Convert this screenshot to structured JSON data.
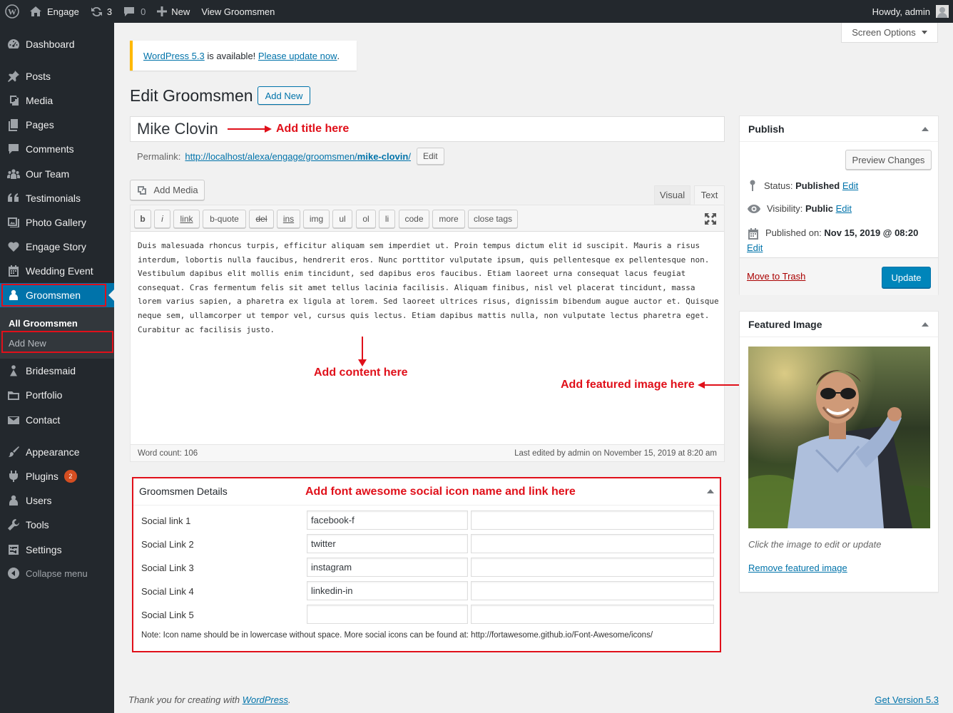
{
  "admin_bar": {
    "site_name": "Engage",
    "updates_count": "3",
    "comments_count": "0",
    "new_label": "New",
    "view_label": "View Groomsmen",
    "howdy": "Howdy, admin"
  },
  "sidebar": {
    "items": [
      {
        "label": "Dashboard",
        "icon": "dashboard-icon"
      },
      {
        "label": "Posts",
        "icon": "pin-icon"
      },
      {
        "label": "Media",
        "icon": "media-icon"
      },
      {
        "label": "Pages",
        "icon": "pages-icon"
      },
      {
        "label": "Comments",
        "icon": "comment-icon"
      },
      {
        "label": "Our Team",
        "icon": "groups-icon"
      },
      {
        "label": "Testimonials",
        "icon": "quote-icon"
      },
      {
        "label": "Photo Gallery",
        "icon": "gallery-icon"
      },
      {
        "label": "Engage Story",
        "icon": "heart-icon"
      },
      {
        "label": "Wedding Event",
        "icon": "calendar-icon"
      },
      {
        "label": "Groomsmen",
        "icon": "user-icon"
      },
      {
        "label": "Bridesmaid",
        "icon": "woman-icon"
      },
      {
        "label": "Portfolio",
        "icon": "portfolio-icon"
      },
      {
        "label": "Contact",
        "icon": "email-icon"
      },
      {
        "label": "Appearance",
        "icon": "brush-icon"
      },
      {
        "label": "Plugins",
        "icon": "plugin-icon",
        "badge": "2"
      },
      {
        "label": "Users",
        "icon": "users-icon"
      },
      {
        "label": "Tools",
        "icon": "wrench-icon"
      },
      {
        "label": "Settings",
        "icon": "settings-icon"
      },
      {
        "label": "Collapse menu",
        "icon": "collapse-icon"
      }
    ],
    "submenu": {
      "all": "All Groomsmen",
      "add_new": "Add New"
    }
  },
  "screen_options": "Screen Options",
  "notice": {
    "link1": "WordPress 5.3",
    "middle": " is available! ",
    "link2": "Please update now",
    "end": "."
  },
  "page": {
    "title": "Edit Groomsmen",
    "add_new": "Add New"
  },
  "post": {
    "title": "Mike Clovin",
    "permalink_label": "Permalink:",
    "permalink_base": "http://localhost/alexa/engage/groomsmen/",
    "permalink_slug": "mike-clovin",
    "permalink_end": "/",
    "permalink_edit": "Edit"
  },
  "editor": {
    "add_media": "Add Media",
    "tab_visual": "Visual",
    "tab_text": "Text",
    "quicktags": [
      "b",
      "i",
      "link",
      "b-quote",
      "del",
      "ins",
      "img",
      "ul",
      "ol",
      "li",
      "code",
      "more",
      "close tags"
    ],
    "content": "Duis malesuada rhoncus turpis, efficitur aliquam sem imperdiet ut. Proin tempus dictum elit id suscipit. Mauris a risus interdum, lobortis nulla faucibus, hendrerit eros. Nunc porttitor vulputate ipsum, quis pellentesque ex pellentesque non. Vestibulum dapibus elit mollis enim tincidunt, sed dapibus eros faucibus. Etiam laoreet urna consequat lacus feugiat consequat. Cras fermentum felis sit amet tellus lacinia facilisis. Aliquam finibus, nisl vel placerat tincidunt, massa lorem varius sapien, a pharetra ex ligula at lorem. Sed laoreet ultrices risus, dignissim bibendum augue auctor et. Quisque neque sem, ullamcorper ut tempor vel, cursus quis lectus. Etiam dapibus mattis nulla, non vulputate lectus pharetra eget. Curabitur ac facilisis justo.",
    "word_count": "Word count: 106",
    "last_edited": "Last edited by admin on November 15, 2019 at 8:20 am"
  },
  "annotations": {
    "title": "Add title here",
    "content": "Add content here",
    "featured": "Add featured image here",
    "social": "Add font awesome social icon name and link here"
  },
  "groomsmen_details": {
    "title": "Groomsmen Details",
    "rows": [
      {
        "label": "Social link 1",
        "icon": "facebook-f",
        "link": ""
      },
      {
        "label": "Social Link 2",
        "icon": "twitter",
        "link": ""
      },
      {
        "label": "Social Link 3",
        "icon": "instagram",
        "link": ""
      },
      {
        "label": "Social Link 4",
        "icon": "linkedin-in",
        "link": ""
      },
      {
        "label": "Social Link 5",
        "icon": "",
        "link": ""
      }
    ],
    "note": "Note: Icon name should be in lowercase without space. More social icons can be found at: http://fortawesome.github.io/Font-Awesome/icons/"
  },
  "publish": {
    "title": "Publish",
    "preview": "Preview Changes",
    "status_label": "Status:",
    "status_value": "Published",
    "visibility_label": "Visibility:",
    "visibility_value": "Public",
    "published_label": "Published on:",
    "published_value": "Nov 15, 2019 @ 08:20",
    "edit": "Edit",
    "trash": "Move to Trash",
    "update": "Update"
  },
  "featured_image": {
    "title": "Featured Image",
    "hint": "Click the image to edit or update",
    "remove": "Remove featured image"
  },
  "footer": {
    "thanks_prefix": "Thank you for creating with ",
    "thanks_link": "WordPress",
    "thanks_end": ".",
    "version": "Get Version 5.3"
  },
  "colors": {
    "sidebar_bg": "#23282d",
    "accent": "#0073aa",
    "annotation_red": "#e0101a",
    "notice_warning": "#ffb900"
  }
}
